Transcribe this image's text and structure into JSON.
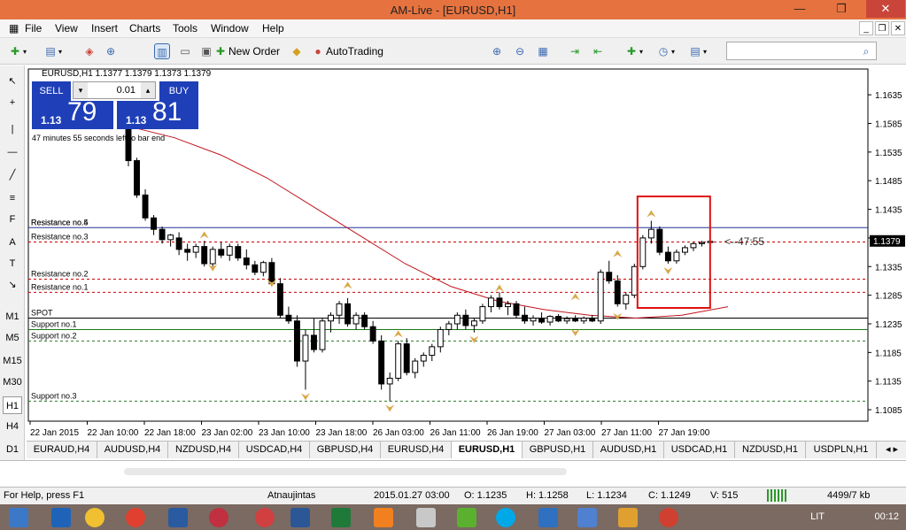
{
  "window": {
    "title": "AM-Live - [EURUSD,H1]",
    "min": "—",
    "restore": "❐",
    "close": "✕"
  },
  "menu": [
    "File",
    "View",
    "Insert",
    "Charts",
    "Tools",
    "Window",
    "Help"
  ],
  "mdi_controls": [
    "_",
    "❐",
    "✕"
  ],
  "toolbar": {
    "new_order": "New Order",
    "autotrading": "AutoTrading"
  },
  "left_tools": [
    "↖",
    "+",
    "|",
    "—",
    "╱",
    "≡",
    "F",
    "A",
    "T",
    "↘"
  ],
  "timeframes": [
    "M1",
    "M5",
    "M15",
    "M30",
    "H1",
    "H4",
    "D1"
  ],
  "chart": {
    "header": "EURUSD,H1  1.1377 1.1379 1.1373 1.1379",
    "timer_text": "47 minutes 55 seconds left to bar end",
    "countdown": "<--47:55",
    "current_price_label": "1.1379",
    "y_ticks": [
      "1.1635",
      "1.1585",
      "1.1535",
      "1.1485",
      "1.1435",
      "1.1385",
      "1.1335",
      "1.1285",
      "1.1235",
      "1.1185",
      "1.1135",
      "1.1085"
    ],
    "x_ticks": [
      "22 Jan 2015",
      "22 Jan 10:00",
      "22 Jan 18:00",
      "23 Jan 02:00",
      "23 Jan 10:00",
      "23 Jan 18:00",
      "26 Jan 03:00",
      "26 Jan 11:00",
      "26 Jan 19:00",
      "27 Jan 03:00",
      "27 Jan 11:00",
      "27 Jan 19:00"
    ],
    "levels": [
      {
        "label": "Resistance no.4",
        "value": 1.1403
      },
      {
        "label": "Resistance no.5",
        "value": 1.1403
      },
      {
        "label": "Resistance no.3",
        "value": 1.1378
      },
      {
        "label": "Resistance no.2",
        "value": 1.1313
      },
      {
        "label": "Resistance no.1",
        "value": 1.129
      },
      {
        "label": "SPOT",
        "value": 1.1245
      },
      {
        "label": "Support no.1",
        "value": 1.1225
      },
      {
        "label": "Support no.2",
        "value": 1.1205
      },
      {
        "label": "Support no.3",
        "value": 1.11
      }
    ]
  },
  "trade_panel": {
    "sell": "SELL",
    "buy": "BUY",
    "lot": "0.01",
    "sell_small": "1.13",
    "sell_big": "79",
    "buy_small": "1.13",
    "buy_big": "81"
  },
  "tabs": [
    "EURAUD,H4",
    "AUDUSD,H4",
    "NZDUSD,H4",
    "USDCAD,H4",
    "GBPUSD,H4",
    "EURUSD,H4",
    "EURUSD,H1",
    "GBPUSD,H1",
    "AUDUSD,H1",
    "USDCAD,H1",
    "NZDUSD,H1",
    "USDPLN,H1"
  ],
  "active_tab": "EURUSD,H1",
  "status": {
    "help": "For Help, press F1",
    "profile": "Atnaujintas",
    "datetime": "2015.01.27 03:00",
    "open": "O: 1.1235",
    "high": "H: 1.1258",
    "low": "L: 1.1234",
    "close": "C: 1.1249",
    "volume": "V: 515",
    "traffic": "4499/7 kb"
  },
  "taskbar": {
    "lang": "LIT",
    "time": "00:12"
  },
  "chart_data": {
    "type": "candlestick",
    "symbol": "EURUSD",
    "timeframe": "H1",
    "ylim": [
      1.1065,
      1.168
    ],
    "candles": [
      [
        1.16,
        1.162,
        1.151,
        1.152
      ],
      [
        1.152,
        1.1525,
        1.1455,
        1.146
      ],
      [
        1.146,
        1.147,
        1.1415,
        1.142
      ],
      [
        1.142,
        1.1425,
        1.139,
        1.14
      ],
      [
        1.14,
        1.1405,
        1.1375,
        1.1382
      ],
      [
        1.1382,
        1.1392,
        1.137,
        1.139
      ],
      [
        1.1385,
        1.1395,
        1.1355,
        1.1365
      ],
      [
        1.1365,
        1.1375,
        1.1345,
        1.136
      ],
      [
        1.136,
        1.1375,
        1.135,
        1.137
      ],
      [
        1.137,
        1.138,
        1.1335,
        1.134
      ],
      [
        1.134,
        1.137,
        1.1335,
        1.1365
      ],
      [
        1.1365,
        1.1378,
        1.135,
        1.1355
      ],
      [
        1.1355,
        1.1375,
        1.1345,
        1.137
      ],
      [
        1.137,
        1.1375,
        1.1345,
        1.135
      ],
      [
        1.135,
        1.1365,
        1.133,
        1.1338
      ],
      [
        1.1338,
        1.1345,
        1.132,
        1.1325
      ],
      [
        1.1325,
        1.1345,
        1.1318,
        1.1342
      ],
      [
        1.1342,
        1.135,
        1.13,
        1.1305
      ],
      [
        1.1305,
        1.1315,
        1.1245,
        1.125
      ],
      [
        1.125,
        1.1265,
        1.1235,
        1.124
      ],
      [
        1.124,
        1.125,
        1.116,
        1.117
      ],
      [
        1.117,
        1.1225,
        1.112,
        1.1215
      ],
      [
        1.1215,
        1.1245,
        1.1185,
        1.119
      ],
      [
        1.119,
        1.1245,
        1.1185,
        1.124
      ],
      [
        1.124,
        1.1255,
        1.122,
        1.125
      ],
      [
        1.125,
        1.1275,
        1.1235,
        1.127
      ],
      [
        1.127,
        1.128,
        1.123,
        1.1235
      ],
      [
        1.1235,
        1.1255,
        1.1225,
        1.125
      ],
      [
        1.125,
        1.1255,
        1.1225,
        1.123
      ],
      [
        1.123,
        1.124,
        1.12,
        1.1205
      ],
      [
        1.1205,
        1.1215,
        1.112,
        1.113
      ],
      [
        1.113,
        1.115,
        1.11,
        1.114
      ],
      [
        1.114,
        1.1205,
        1.1135,
        1.12
      ],
      [
        1.12,
        1.121,
        1.1145,
        1.115
      ],
      [
        1.115,
        1.1175,
        1.114,
        1.117
      ],
      [
        1.117,
        1.1185,
        1.116,
        1.118
      ],
      [
        1.118,
        1.12,
        1.117,
        1.1195
      ],
      [
        1.1195,
        1.123,
        1.1185,
        1.1225
      ],
      [
        1.1225,
        1.124,
        1.1215,
        1.1235
      ],
      [
        1.1235,
        1.1255,
        1.1225,
        1.125
      ],
      [
        1.125,
        1.126,
        1.1225,
        1.1232
      ],
      [
        1.1232,
        1.1245,
        1.122,
        1.124
      ],
      [
        1.124,
        1.127,
        1.1235,
        1.1265
      ],
      [
        1.1265,
        1.1285,
        1.1255,
        1.128
      ],
      [
        1.128,
        1.129,
        1.126,
        1.1265
      ],
      [
        1.1265,
        1.1275,
        1.125,
        1.127
      ],
      [
        1.127,
        1.1275,
        1.1245,
        1.125
      ],
      [
        1.125,
        1.1265,
        1.1235,
        1.124
      ],
      [
        1.124,
        1.125,
        1.1232,
        1.1245
      ],
      [
        1.1245,
        1.1255,
        1.1235,
        1.1238
      ],
      [
        1.1238,
        1.125,
        1.1232,
        1.1248
      ],
      [
        1.1248,
        1.1252,
        1.1238,
        1.124
      ],
      [
        1.124,
        1.1248,
        1.1235,
        1.1244
      ],
      [
        1.1244,
        1.125,
        1.1238,
        1.124
      ],
      [
        1.124,
        1.1248,
        1.1235,
        1.1245
      ],
      [
        1.1245,
        1.125,
        1.1238,
        1.124
      ],
      [
        1.124,
        1.133,
        1.1235,
        1.1325
      ],
      [
        1.1325,
        1.1345,
        1.1305,
        1.131
      ],
      [
        1.131,
        1.132,
        1.1265,
        1.127
      ],
      [
        1.127,
        1.129,
        1.126,
        1.1285
      ],
      [
        1.1285,
        1.134,
        1.128,
        1.1335
      ],
      [
        1.1335,
        1.139,
        1.133,
        1.1385
      ],
      [
        1.1385,
        1.1415,
        1.1375,
        1.14
      ],
      [
        1.14,
        1.1405,
        1.1355,
        1.136
      ],
      [
        1.136,
        1.137,
        1.134,
        1.1345
      ],
      [
        1.1345,
        1.1365,
        1.134,
        1.136
      ],
      [
        1.136,
        1.1372,
        1.1355,
        1.1368
      ],
      [
        1.1368,
        1.1378,
        1.1362,
        1.1375
      ],
      [
        1.1375,
        1.138,
        1.137,
        1.1377
      ],
      [
        1.1377,
        1.1379,
        1.1373,
        1.1379
      ]
    ],
    "moving_average": [
      1.158,
      1.156,
      1.153,
      1.149,
      1.144,
      1.139,
      1.134,
      1.13,
      1.1275,
      1.126,
      1.125,
      1.1245,
      1.125,
      1.1265
    ],
    "up_fractals": [
      [
        9,
        1.1378
      ],
      [
        26,
        1.129
      ],
      [
        32,
        1.1205
      ],
      [
        44,
        1.1285
      ],
      [
        53,
        1.127
      ],
      [
        58,
        1.1345
      ],
      [
        62,
        1.1415
      ]
    ],
    "down_fractals": [
      [
        10,
        1.1345
      ],
      [
        17,
        1.1318
      ],
      [
        21,
        1.112
      ],
      [
        31,
        1.11
      ],
      [
        41,
        1.122
      ],
      [
        53,
        1.1232
      ],
      [
        58,
        1.126
      ],
      [
        64,
        1.134
      ]
    ]
  }
}
